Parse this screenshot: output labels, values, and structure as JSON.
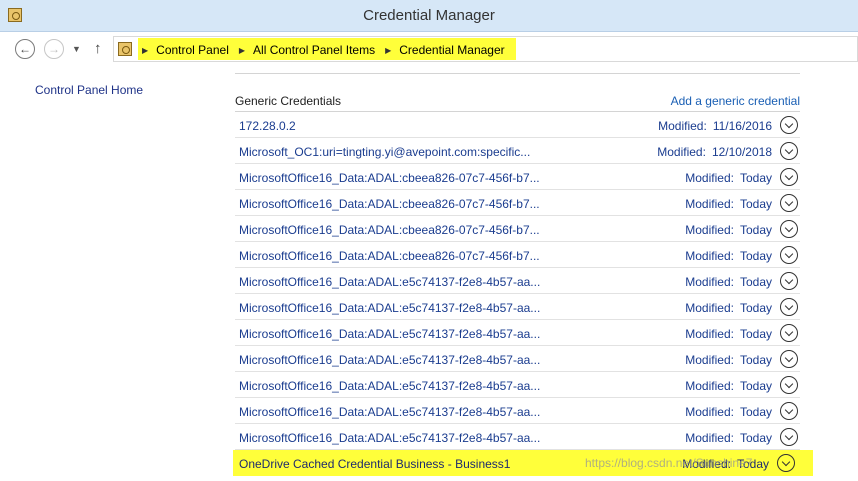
{
  "window": {
    "title": "Credential Manager"
  },
  "nav": {
    "back_icon": "back-arrow-icon",
    "forward_icon": "forward-arrow-icon",
    "up_icon": "up-arrow-icon"
  },
  "breadcrumb": [
    "Control Panel",
    "All Control Panel Items",
    "Credential Manager"
  ],
  "sidebar": {
    "home_link": "Control Panel Home"
  },
  "section": {
    "title": "Generic Credentials",
    "add_link": "Add a generic credential"
  },
  "credentials": [
    {
      "name": "172.28.0.2",
      "modified_label": "Modified:",
      "modified_value": "11/16/2016"
    },
    {
      "name": "Microsoft_OC1:uri=tingting.yi@avepoint.com:specific...",
      "modified_label": "Modified:",
      "modified_value": "12/10/2018"
    },
    {
      "name": "MicrosoftOffice16_Data:ADAL:cbeea826-07c7-456f-b7...",
      "modified_label": "Modified:",
      "modified_value": "Today"
    },
    {
      "name": "MicrosoftOffice16_Data:ADAL:cbeea826-07c7-456f-b7...",
      "modified_label": "Modified:",
      "modified_value": "Today"
    },
    {
      "name": "MicrosoftOffice16_Data:ADAL:cbeea826-07c7-456f-b7...",
      "modified_label": "Modified:",
      "modified_value": "Today"
    },
    {
      "name": "MicrosoftOffice16_Data:ADAL:cbeea826-07c7-456f-b7...",
      "modified_label": "Modified:",
      "modified_value": "Today"
    },
    {
      "name": "MicrosoftOffice16_Data:ADAL:e5c74137-f2e8-4b57-aa...",
      "modified_label": "Modified:",
      "modified_value": "Today"
    },
    {
      "name": "MicrosoftOffice16_Data:ADAL:e5c74137-f2e8-4b57-aa...",
      "modified_label": "Modified:",
      "modified_value": "Today"
    },
    {
      "name": "MicrosoftOffice16_Data:ADAL:e5c74137-f2e8-4b57-aa...",
      "modified_label": "Modified:",
      "modified_value": "Today"
    },
    {
      "name": "MicrosoftOffice16_Data:ADAL:e5c74137-f2e8-4b57-aa...",
      "modified_label": "Modified:",
      "modified_value": "Today"
    },
    {
      "name": "MicrosoftOffice16_Data:ADAL:e5c74137-f2e8-4b57-aa...",
      "modified_label": "Modified:",
      "modified_value": "Today"
    },
    {
      "name": "MicrosoftOffice16_Data:ADAL:e5c74137-f2e8-4b57-aa...",
      "modified_label": "Modified:",
      "modified_value": "Today"
    },
    {
      "name": "MicrosoftOffice16_Data:ADAL:e5c74137-f2e8-4b57-aa...",
      "modified_label": "Modified:",
      "modified_value": "Today"
    },
    {
      "name": "OneDrive Cached Credential Business - Business1",
      "modified_label": "Modified:",
      "modified_value": "Today",
      "highlighted": true
    }
  ],
  "watermark": "https://blog.csdn.net/Sunshine7",
  "colors": {
    "highlight": "#ffff3a",
    "link": "#1a3c8f",
    "titlebar": "#d6e7f7"
  }
}
